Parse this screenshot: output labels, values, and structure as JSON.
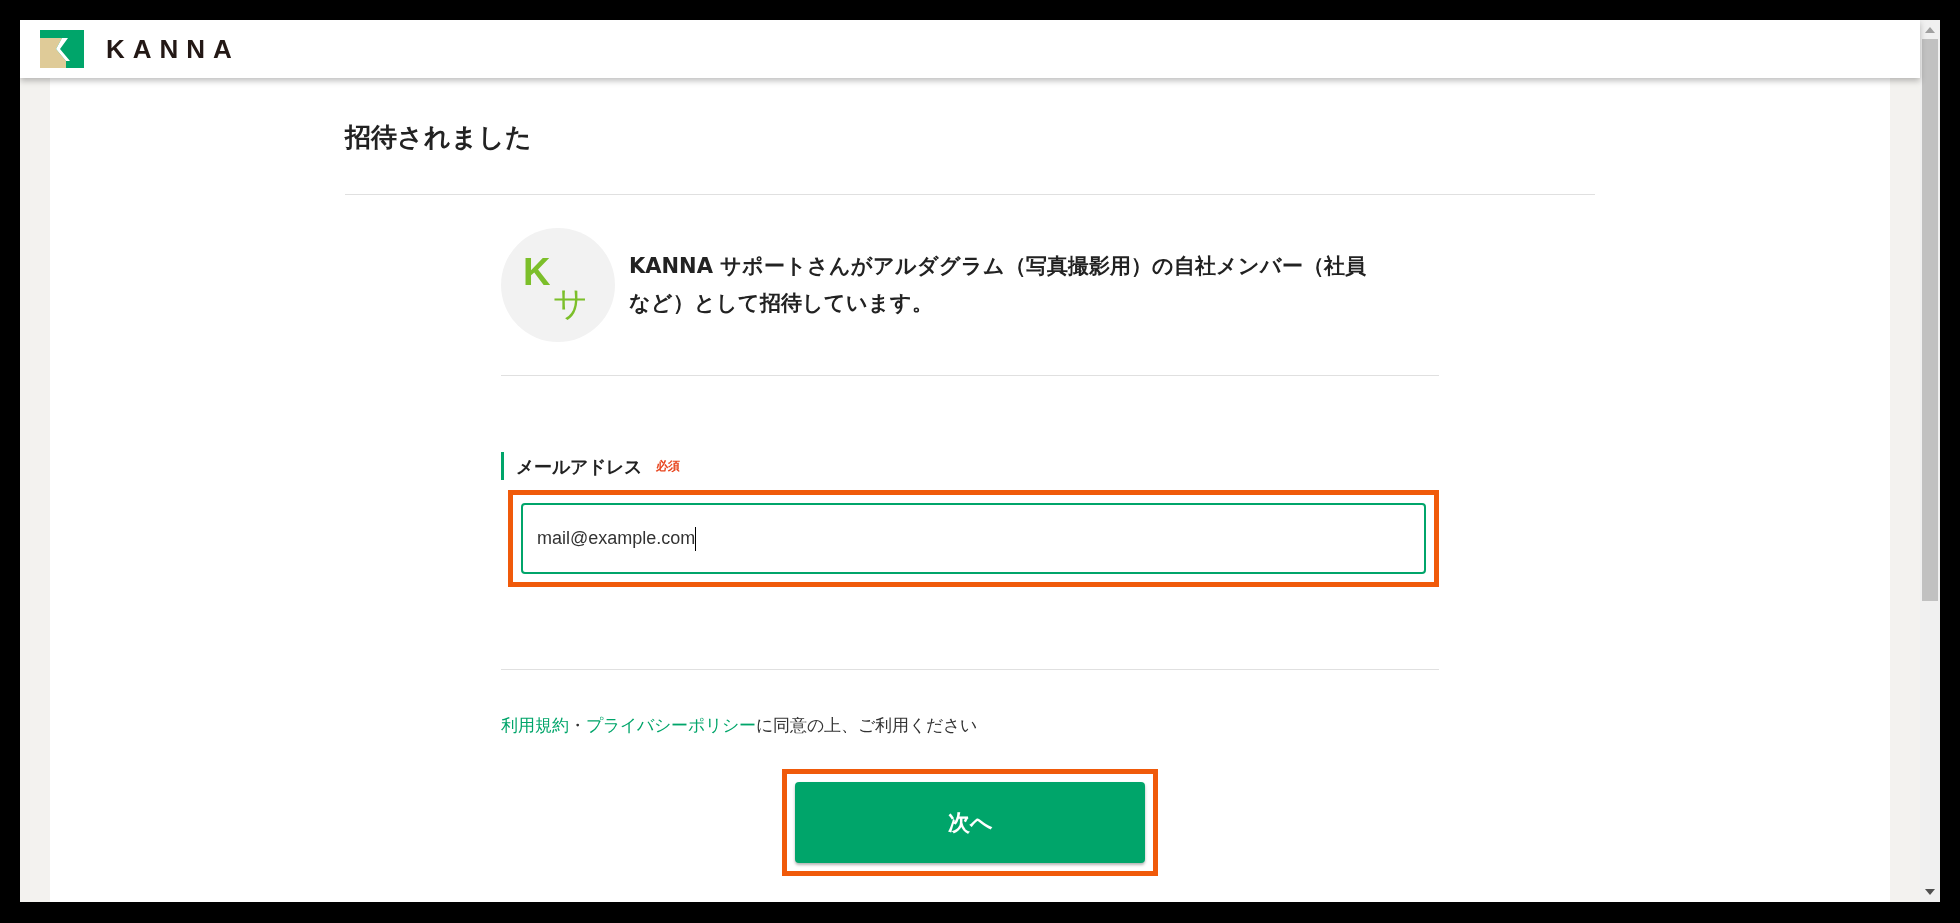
{
  "header": {
    "logo_text": "KANNA"
  },
  "page": {
    "title": "招待されました"
  },
  "invitation": {
    "avatar_initials": [
      "K",
      "サ"
    ],
    "message": "KANNA サポートさんがアルダグラム（写真撮影用）の自社メンバー（社員など）として招待しています。"
  },
  "email_field": {
    "label": "メールアドレス",
    "required_badge": "必須",
    "value": "mail@example.com",
    "focused": true,
    "highlighted": true
  },
  "terms": {
    "links": [
      "利用規約",
      "プライバシーポリシー"
    ],
    "separator": "・",
    "text": "に同意の上、ご利用ください"
  },
  "next_button": {
    "label": "次へ",
    "highlighted": true
  }
}
